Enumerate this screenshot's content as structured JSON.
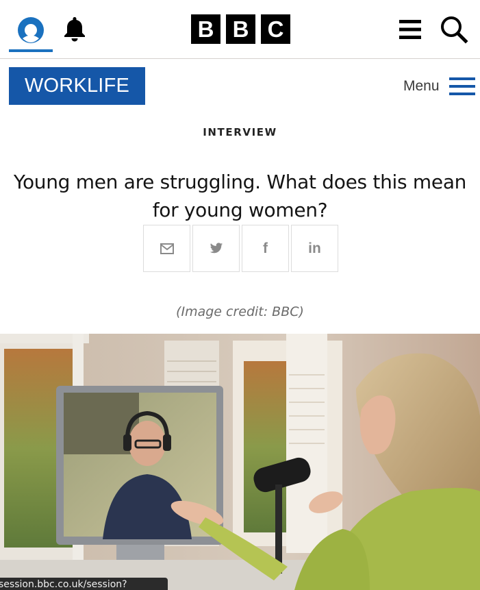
{
  "header": {
    "logo_letters": [
      "B",
      "B",
      "C"
    ],
    "icons": [
      "account-icon",
      "notifications-bell-icon",
      "hamburger-menu-icon",
      "search-icon"
    ],
    "accent_color": "#1a71bf"
  },
  "section_nav": {
    "section_label": "WORKLIFE",
    "section_color": "#1557a8",
    "menu_label": "Menu"
  },
  "article": {
    "kicker": "INTERVIEW",
    "headline": "Young men are struggling. What does this mean for young women?",
    "share_buttons": [
      {
        "name": "email",
        "icon": "email-icon"
      },
      {
        "name": "twitter",
        "icon": "twitter-icon"
      },
      {
        "name": "facebook",
        "icon": "facebook-icon",
        "glyph": "f"
      },
      {
        "name": "linkedin",
        "icon": "linkedin-icon",
        "glyph": "in"
      }
    ],
    "image_credit": "(Image credit: BBC)"
  },
  "browser_status": {
    "url_text": "session.bbc.co.uk/session?"
  }
}
